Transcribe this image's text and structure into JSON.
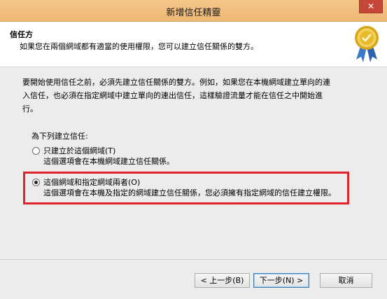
{
  "window": {
    "title": "新增信任精靈",
    "close_label": "✕"
  },
  "header": {
    "title": "信任方",
    "subtitle": "如果您在兩個網域都有適當的使用權限，您可以建立信任關係的雙方。",
    "badge_icon": "certificate-ribbon-icon"
  },
  "content": {
    "intro_lines": [
      "要開始使用信任之前，必須先建立信任關係的雙方。例如，如果您在本機網域建立單向的連",
      "入信任，也必須在指定網域中建立單向的連出信任，這樣驗證流量才能在信任之中開始進",
      "行。"
    ],
    "group_label": "為下列建立信任:",
    "options": [
      {
        "label": "只建立於這個網域(T)",
        "description": "這個選項會在本機網域建立信任關係。",
        "checked": false
      },
      {
        "label": "這個網域和指定網域兩者(O)",
        "description": "這個選項會在本機及指定的網域建立信任關係，您必須擁有指定網域的信任建立權限。",
        "checked": true
      }
    ],
    "highlight_color": "#e0242c"
  },
  "footer": {
    "back_label": "< 上一步(B)",
    "next_label": "下一步(N) >",
    "cancel_label": "取消"
  },
  "colors": {
    "titlebar": "#efb873",
    "close_button": "#c7463a",
    "content_bg": "#ececec"
  }
}
